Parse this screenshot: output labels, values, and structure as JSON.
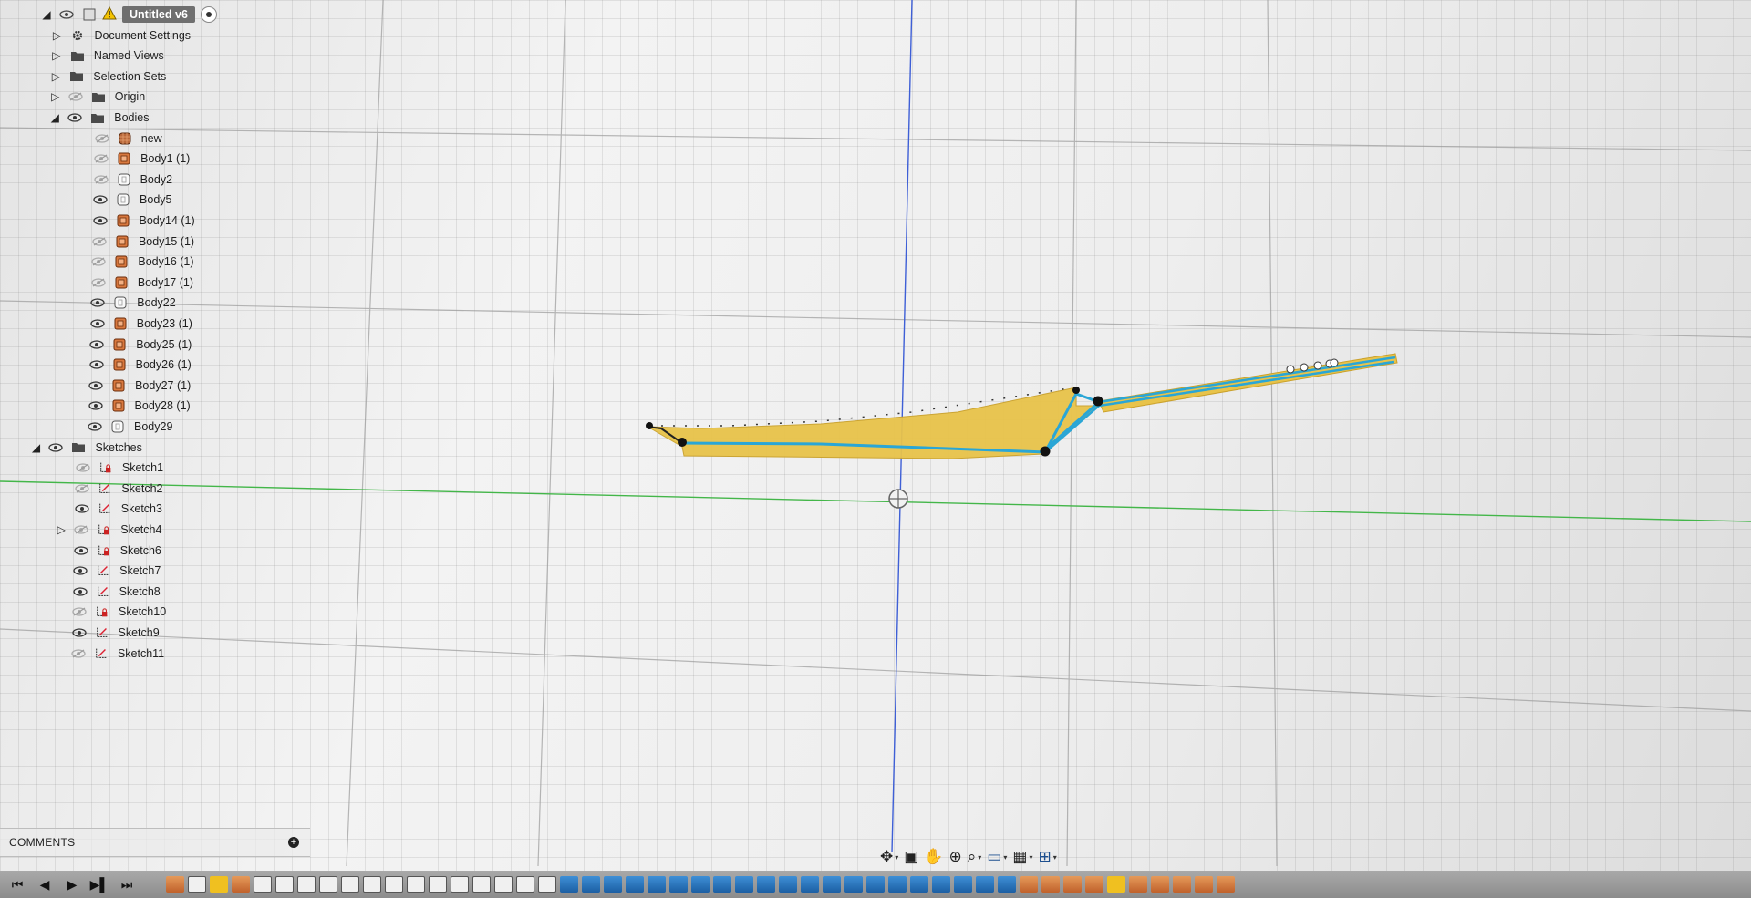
{
  "document": {
    "title": "Untitled v6"
  },
  "browser": {
    "items": [
      {
        "label": "Document Settings",
        "icon": "gear-icon",
        "visible": null,
        "expand": "collapsed"
      },
      {
        "label": "Named Views",
        "icon": "folder-icon",
        "visible": null,
        "expand": "collapsed"
      },
      {
        "label": "Selection Sets",
        "icon": "folder-icon",
        "visible": null,
        "expand": "collapsed"
      },
      {
        "label": "Origin",
        "icon": "folder-icon",
        "visible": false,
        "expand": "collapsed"
      },
      {
        "label": "Bodies",
        "icon": "folder-icon",
        "visible": true,
        "expand": "expanded"
      }
    ],
    "bodies": [
      {
        "label": "new",
        "icon": "body-mesh-icon",
        "visible": false
      },
      {
        "label": "Body1 (1)",
        "icon": "body-component-icon",
        "visible": false
      },
      {
        "label": "Body2",
        "icon": "body-icon",
        "visible": false
      },
      {
        "label": "Body5",
        "icon": "body-icon",
        "visible": true
      },
      {
        "label": "Body14 (1)",
        "icon": "body-component-icon",
        "visible": true
      },
      {
        "label": "Body15 (1)",
        "icon": "body-component-icon",
        "visible": false
      },
      {
        "label": "Body16 (1)",
        "icon": "body-component-icon",
        "visible": false
      },
      {
        "label": "Body17 (1)",
        "icon": "body-component-icon",
        "visible": false
      },
      {
        "label": "Body22",
        "icon": "body-icon",
        "visible": true
      },
      {
        "label": "Body23 (1)",
        "icon": "body-component-icon",
        "visible": true
      },
      {
        "label": "Body25 (1)",
        "icon": "body-component-icon",
        "visible": true
      },
      {
        "label": "Body26 (1)",
        "icon": "body-component-icon",
        "visible": true
      },
      {
        "label": "Body27 (1)",
        "icon": "body-component-icon",
        "visible": true
      },
      {
        "label": "Body28 (1)",
        "icon": "body-component-icon",
        "visible": true
      },
      {
        "label": "Body29",
        "icon": "body-icon",
        "visible": true
      }
    ],
    "sketches_folder": {
      "label": "Sketches",
      "icon": "folder-icon",
      "visible": true,
      "expand": "expanded"
    },
    "sketches": [
      {
        "label": "Sketch1",
        "icon": "sketch-locked-icon",
        "visible": false
      },
      {
        "label": "Sketch2",
        "icon": "sketch-icon",
        "visible": false
      },
      {
        "label": "Sketch3",
        "icon": "sketch-icon",
        "visible": true
      },
      {
        "label": "Sketch4",
        "icon": "sketch-locked-icon",
        "visible": false,
        "expand": "collapsed"
      },
      {
        "label": "Sketch6",
        "icon": "sketch-locked-icon",
        "visible": true
      },
      {
        "label": "Sketch7",
        "icon": "sketch-icon",
        "visible": true
      },
      {
        "label": "Sketch8",
        "icon": "sketch-icon",
        "visible": true
      },
      {
        "label": "Sketch10",
        "icon": "sketch-locked-icon",
        "visible": false
      },
      {
        "label": "Sketch9",
        "icon": "sketch-icon",
        "visible": true
      },
      {
        "label": "Sketch11",
        "icon": "sketch-icon",
        "visible": false
      }
    ]
  },
  "comments": {
    "label": "COMMENTS"
  },
  "navbar": {
    "tools": [
      "orbit-icon",
      "look-at-icon",
      "pan-icon",
      "zoom-icon",
      "fit-icon",
      "display-settings-icon",
      "grid-icon",
      "viewports-icon"
    ]
  },
  "timeline": {
    "controls": [
      "skip-to-start-icon",
      "step-back-icon",
      "play-icon",
      "step-forward-icon",
      "skip-to-end-icon"
    ],
    "feature_kinds": [
      "body",
      "sketch",
      "gold",
      "body",
      "sketch",
      "sketch",
      "sketch",
      "sketch",
      "sketch",
      "sketch",
      "sketch",
      "sketch",
      "sketch",
      "sketch",
      "sketch",
      "sketch",
      "sketch",
      "sketch",
      "ext",
      "ext",
      "ext",
      "ext",
      "ext",
      "ext",
      "ext",
      "ext",
      "ext",
      "ext",
      "ext",
      "ext",
      "ext",
      "ext",
      "ext",
      "ext",
      "ext",
      "ext",
      "ext",
      "ext",
      "ext",
      "body",
      "body",
      "body",
      "body",
      "gold",
      "body",
      "body",
      "body",
      "body",
      "body"
    ]
  },
  "colors": {
    "body_fill": "#e8c34a",
    "sketch_line": "#2aa6d6",
    "x_axis": "#43b649",
    "z_axis": "#3e5fd6"
  }
}
